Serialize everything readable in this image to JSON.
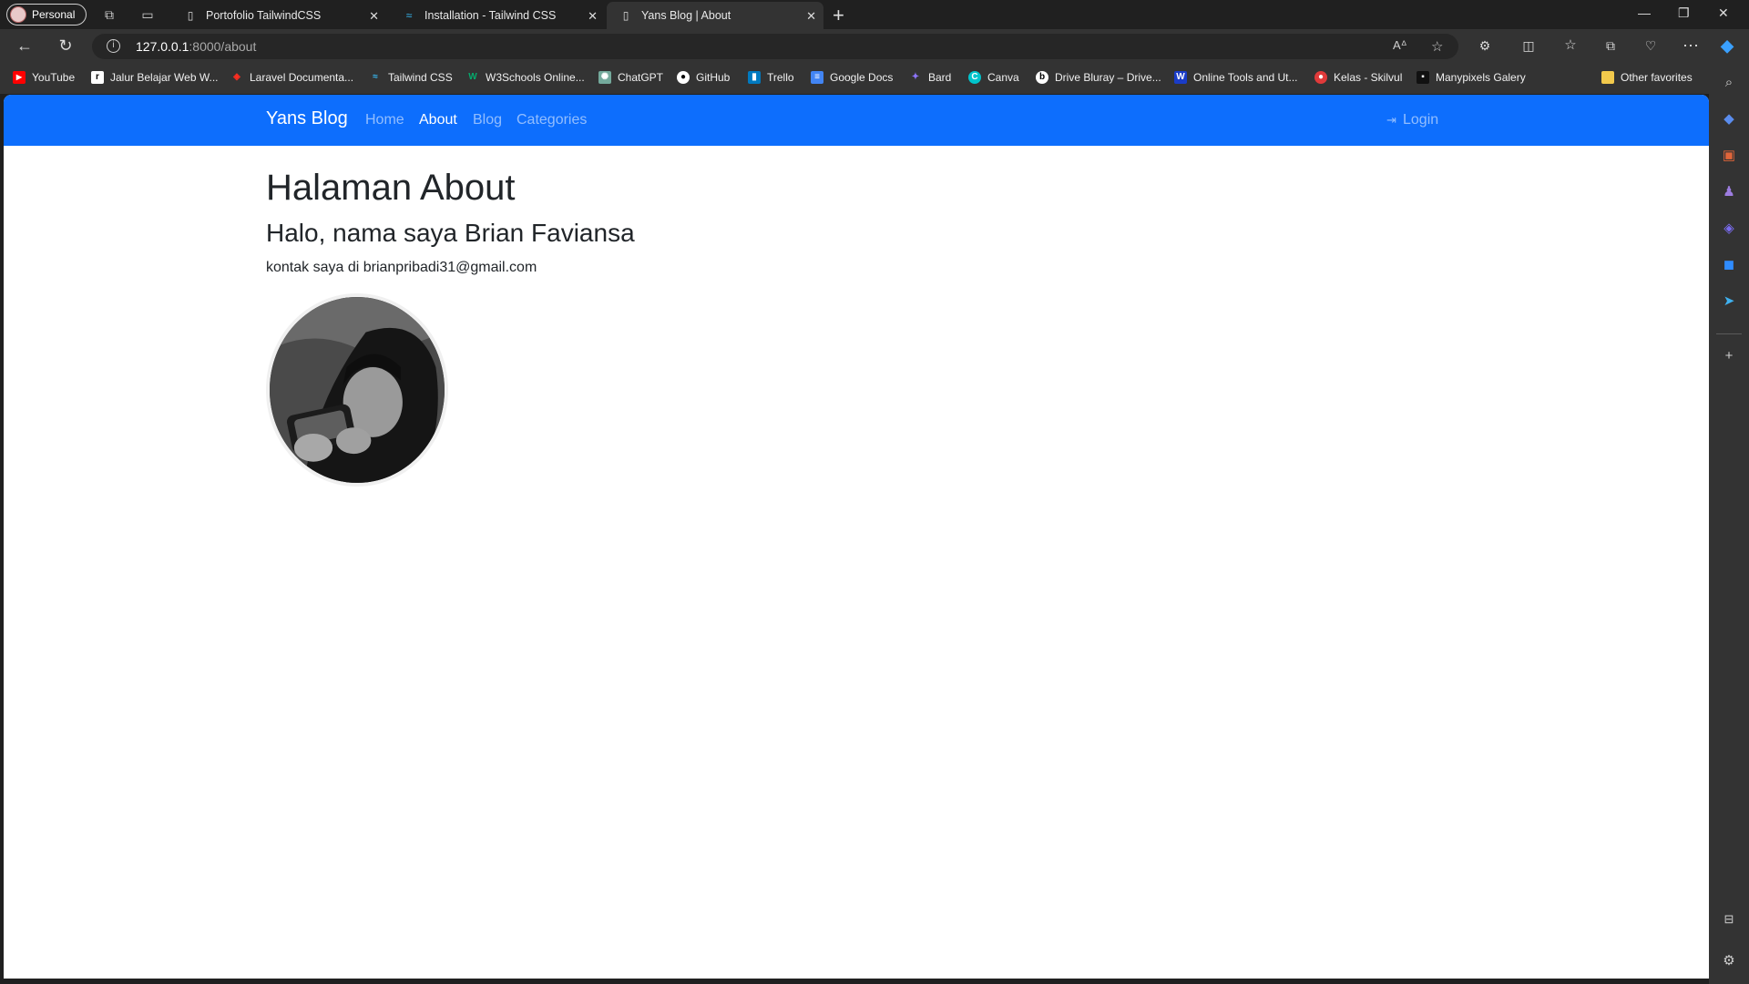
{
  "browser": {
    "profile_label": "Personal",
    "tabs": [
      {
        "title": "Portofolio TailwindCSS",
        "icon": "page-icon"
      },
      {
        "title": "Installation - Tailwind CSS",
        "icon": "tailwind-icon"
      },
      {
        "title": "Yans Blog | About",
        "icon": "page-icon"
      }
    ],
    "address": {
      "host": "127.0.0.1",
      "rest": ":8000/about"
    },
    "bookmarks": [
      {
        "label": "YouTube",
        "color": "#ff0000"
      },
      {
        "label": "Jalur Belajar Web W...",
        "color": "#000000"
      },
      {
        "label": "Laravel Documenta...",
        "color": "#ff2d20"
      },
      {
        "label": "Tailwind CSS",
        "color": "#38bdf8"
      },
      {
        "label": "W3Schools Online...",
        "color": "#04aa6d"
      },
      {
        "label": "ChatGPT",
        "color": "#74aa9c"
      },
      {
        "label": "GitHub",
        "color": "#ffffff"
      },
      {
        "label": "Trello",
        "color": "#0079bf"
      },
      {
        "label": "Google Docs",
        "color": "#4285f4"
      },
      {
        "label": "Bard",
        "color": "#8e75ff"
      },
      {
        "label": "Canva",
        "color": "#00c4cc"
      },
      {
        "label": "Drive Bluray – Drive...",
        "color": "#ffffff"
      },
      {
        "label": "Online Tools and Ut...",
        "color": "#1a3cc7"
      },
      {
        "label": "Kelas - Skilvul",
        "color": "#e03a3a"
      },
      {
        "label": "Manypixels Galery",
        "color": "#111111"
      }
    ],
    "other_favorites": "Other favorites"
  },
  "navbar": {
    "brand": "Yans Blog",
    "links": [
      "Home",
      "About",
      "Blog",
      "Categories"
    ],
    "active_link": "About",
    "login": "Login",
    "color": "#0d6efd"
  },
  "content": {
    "title": "Halaman About",
    "name_line": "Halo, nama saya Brian Faviansa",
    "contact_line": "kontak saya di brianpribadi31@gmail.com"
  }
}
